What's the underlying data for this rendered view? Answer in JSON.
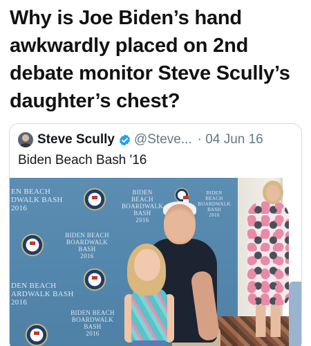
{
  "headline": {
    "line1": "Why is Joe Biden’s hand",
    "line2": "awkwardly placed on 2nd",
    "line3": "debate monitor Steve Scully’s",
    "line4": "daughter’s chest?"
  },
  "tweet": {
    "display_name": "Steve Scully",
    "verified_icon": "verified-badge-icon",
    "handle": "@Steve...",
    "date": "· 04 Jun 16",
    "text": "Biden Beach Bash '16"
  },
  "photo": {
    "backdrop_texts": [
      "EN BEACH\nDWALK BASH\n2016",
      "BIDEN BEACH\nBOARDWALK BASH\n2016",
      "BIDEN BEACH\nBOARDWALK BASH\n2016",
      "BIDEN BEACH\nBOARDWALK BASH\n2016",
      "DEN BEACH\nARDWALK BASH\n2016",
      "BIDEN BEACH\nBOARDWALK BASH\n2016"
    ]
  },
  "colors": {
    "verified": "#1da1f2",
    "muted": "#657786",
    "backdrop": "#5c8db3"
  }
}
